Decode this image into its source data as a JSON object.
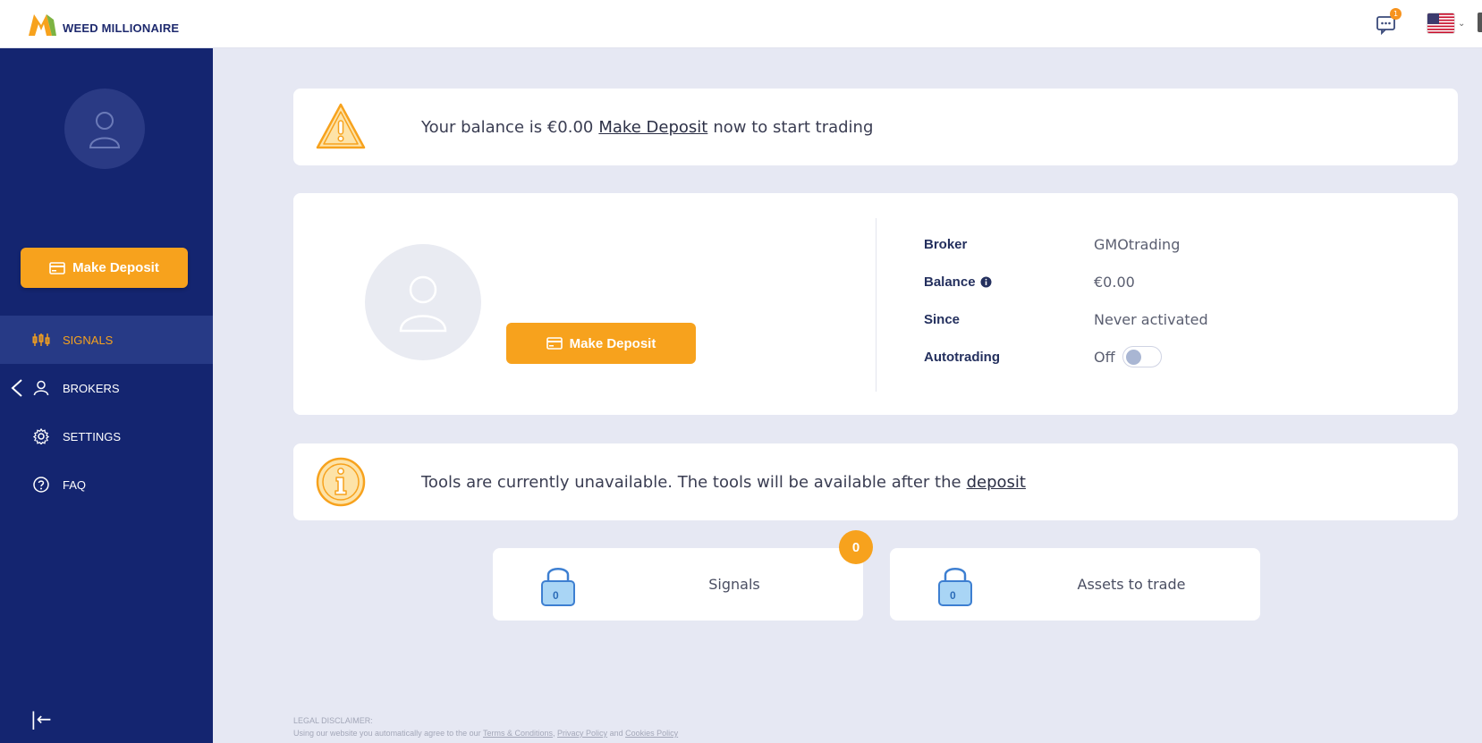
{
  "brand": {
    "name": "WEED MILLIONAIRE"
  },
  "header": {
    "notifications_count": "1",
    "language": "en-US"
  },
  "sidebar": {
    "deposit_button": "Make Deposit",
    "items": [
      {
        "label": "SIGNALS",
        "icon": "signals-icon",
        "active": true
      },
      {
        "label": "BROKERS",
        "icon": "user-icon",
        "active": false
      },
      {
        "label": "SETTINGS",
        "icon": "gear-icon",
        "active": false
      },
      {
        "label": "FAQ",
        "icon": "question-icon",
        "active": false
      }
    ],
    "collapse": "|←"
  },
  "balance_alert": {
    "prefix": "Your balance is €0.00",
    "link": "Make Deposit",
    "suffix": "now to start trading"
  },
  "profile": {
    "deposit_button": "Make Deposit",
    "rows": [
      {
        "label": "Broker",
        "value": "GMOtrading"
      },
      {
        "label": "Balance",
        "value": "€0.00"
      },
      {
        "label": "Since",
        "value": "Never activated"
      },
      {
        "label": "Autotrading",
        "value": "Off"
      }
    ]
  },
  "tools_alert": {
    "text": "Tools are currently unavailable. The tools will be available after the",
    "link": "deposit"
  },
  "tools": [
    {
      "label": "Signals",
      "lock_count": "0",
      "badge": "0"
    },
    {
      "label": "Assets to trade",
      "lock_count": "0"
    }
  ],
  "disclaimer": {
    "title": "LEGAL DISCLAIMER:",
    "text": "Using our website you automatically agree to the our",
    "terms": "Terms & Conditions",
    "comma": ",",
    "privacy": "Privacy Policy",
    "and": "and",
    "cookies": "Cookies Policy"
  },
  "colors": {
    "sidebar": "#142570",
    "accent": "#f7a21d",
    "background": "#e6e8f3"
  }
}
